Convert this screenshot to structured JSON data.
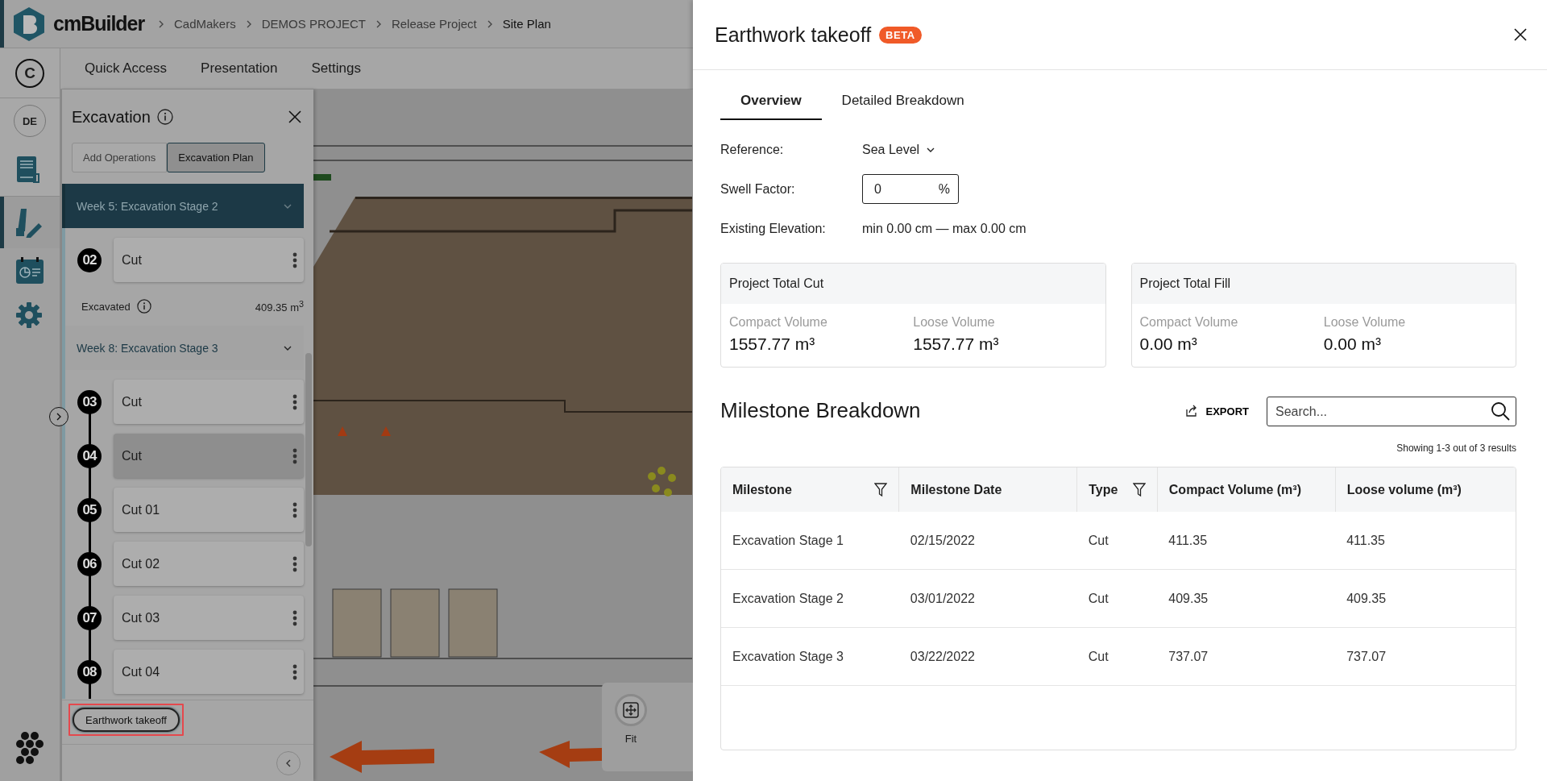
{
  "app": {
    "logo_text": "cmBuilder",
    "breadcrumb": [
      "CadMakers",
      "DEMOS PROJECT",
      "Release Project",
      "Site Plan"
    ],
    "rail": [
      {
        "kind": "letter",
        "label": "C",
        "selected": false
      },
      {
        "kind": "initials",
        "label": "DE",
        "selected": false
      },
      {
        "kind": "book",
        "selected": false
      },
      {
        "kind": "drawing",
        "selected": true
      },
      {
        "kind": "calendar",
        "selected": false
      },
      {
        "kind": "gear",
        "selected": false
      }
    ],
    "menu": [
      "Quick Access",
      "Presentation",
      "Settings"
    ]
  },
  "excavation_panel": {
    "title": "Excavation",
    "modes": [
      {
        "label": "Add Operations",
        "selected": false
      },
      {
        "label": "Excavation Plan",
        "selected": true
      }
    ],
    "groups": [
      {
        "title": "Week 5: Excavation Stage 2",
        "selected": true,
        "expanded": true,
        "operations": [
          {
            "number": "02",
            "name": "Cut",
            "selected": false
          }
        ],
        "excavated_label": "Excavated",
        "excavated_value": "409.35 m$^{3}$"
      },
      {
        "title": "Week 8: Excavation Stage 3",
        "selected": false,
        "expanded": true,
        "operations": [
          {
            "number": "03",
            "name": "Cut",
            "selected": false
          },
          {
            "number": "04",
            "name": "Cut",
            "selected": true
          },
          {
            "number": "05",
            "name": "Cut 01",
            "selected": false
          },
          {
            "number": "06",
            "name": "Cut 02",
            "selected": false
          },
          {
            "number": "07",
            "name": "Cut 03",
            "selected": false
          },
          {
            "number": "08",
            "name": "Cut 04",
            "selected": false
          }
        ]
      }
    ],
    "footer_button": "Earthwork takeoff"
  },
  "viewport": {
    "tools": [
      "Fit"
    ]
  },
  "drawer": {
    "title": "Earthwork takeoff",
    "badge": "BETA",
    "tabs": [
      {
        "label": "Overview",
        "selected": true
      },
      {
        "label": "Detailed Breakdown",
        "selected": false
      }
    ],
    "fields": [
      {
        "kind": "dropdown",
        "label": "Reference:",
        "value": "Sea Level"
      },
      {
        "kind": "input",
        "label": "Swell Factor:",
        "value": "0",
        "unit": "%"
      },
      {
        "kind": "text",
        "label": "Existing Elevation:",
        "value": "min 0.00 cm — max 0.00 cm"
      }
    ],
    "totals": [
      {
        "title": "Project Total Cut",
        "metrics": [
          {
            "label": "Compact Volume",
            "value": "1557.77 m³"
          },
          {
            "label": "Loose Volume",
            "value": "1557.77 m³"
          }
        ]
      },
      {
        "title": "Project Total Fill",
        "metrics": [
          {
            "label": "Compact Volume",
            "value": "0.00 m³"
          },
          {
            "label": "Loose Volume",
            "value": "0.00 m³"
          }
        ]
      }
    ],
    "milestones": {
      "title": "Milestone Breakdown",
      "export": "EXPORT",
      "search": {
        "placeholder": "Search..."
      },
      "results": "Showing 1-3 out of 3 results",
      "columns": [
        {
          "label": "Milestone",
          "filterable": true
        },
        {
          "label": "Milestone Date",
          "filterable": false
        },
        {
          "label": "Type",
          "filterable": true
        },
        {
          "label": "Compact Volume (m³)",
          "filterable": false
        },
        {
          "label": "Loose volume (m³)",
          "filterable": false
        }
      ],
      "rows": [
        [
          "Excavation Stage 1",
          "02/15/2022",
          "Cut",
          "411.35",
          "411.35"
        ],
        [
          "Excavation Stage 2",
          "03/01/2022",
          "Cut",
          "409.35",
          "409.35"
        ],
        [
          "Excavation Stage 3",
          "03/22/2022",
          "Cut",
          "737.07",
          "737.07"
        ]
      ]
    }
  }
}
